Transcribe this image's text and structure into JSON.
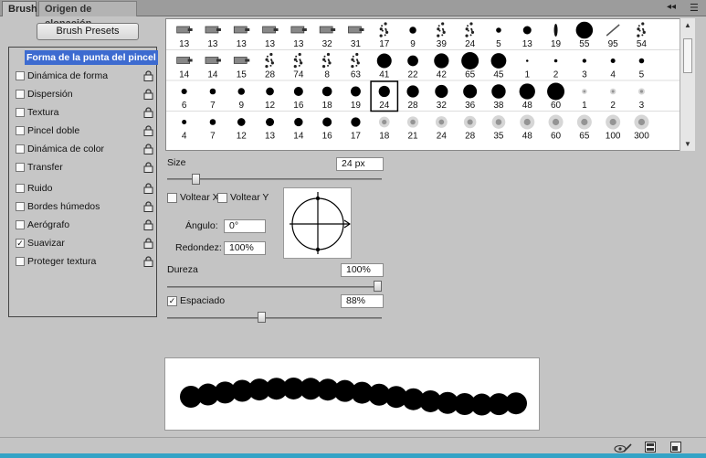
{
  "tabs": {
    "active": "Brush",
    "inactive": "Origen de clonación",
    "controls": "◂◂ ☰",
    "collapse_icon": "double-chevron-icon",
    "menu_icon": "panel-menu-icon"
  },
  "presets_button": "Brush Presets",
  "options": [
    {
      "label": "Forma de la punta del pincel",
      "checked": false,
      "selected": true,
      "lock": false,
      "nocheck": true
    },
    {
      "label": "Dinámica de forma",
      "checked": false,
      "selected": false,
      "lock": true
    },
    {
      "label": "Dispersión",
      "checked": false,
      "selected": false,
      "lock": true
    },
    {
      "label": "Textura",
      "checked": false,
      "selected": false,
      "lock": true
    },
    {
      "label": "Pincel doble",
      "checked": false,
      "selected": false,
      "lock": true
    },
    {
      "label": "Dinámica de color",
      "checked": false,
      "selected": false,
      "lock": true
    },
    {
      "label": "Transfer",
      "checked": false,
      "selected": false,
      "lock": true
    },
    {
      "label": "Ruido",
      "checked": false,
      "selected": false,
      "lock": true
    },
    {
      "label": "Bordes húmedos",
      "checked": false,
      "selected": false,
      "lock": true
    },
    {
      "label": "Aerógrafo",
      "checked": false,
      "selected": false,
      "lock": true
    },
    {
      "label": "Suavizar",
      "checked": true,
      "selected": false,
      "lock": true
    },
    {
      "label": "Proteger textura",
      "checked": false,
      "selected": false,
      "lock": true
    }
  ],
  "brush_rows": [
    [
      "13",
      "13",
      "13",
      "13",
      "13",
      "32",
      "31",
      "17",
      "9",
      "39",
      "24",
      "5",
      "13",
      "19",
      "55",
      "95",
      "54"
    ],
    [
      "14",
      "14",
      "15",
      "28",
      "74",
      "8",
      "63",
      "41",
      "22",
      "42",
      "65",
      "45",
      "1",
      "2",
      "3",
      "4",
      "5"
    ],
    [
      "6",
      "7",
      "9",
      "12",
      "16",
      "18",
      "19",
      "24",
      "28",
      "32",
      "36",
      "38",
      "48",
      "60",
      "1",
      "2",
      "3"
    ],
    [
      "4",
      "7",
      "12",
      "13",
      "14",
      "16",
      "17",
      "18",
      "21",
      "24",
      "28",
      "35",
      "48",
      "60",
      "65",
      "100",
      "300"
    ]
  ],
  "selected_brush": "24",
  "size": {
    "label": "Size",
    "value": "24 px",
    "slider": 0.12
  },
  "flip": {
    "x_label": "Voltear X",
    "y_label": "Voltear Y",
    "x_checked": false,
    "y_checked": false
  },
  "angle": {
    "label": "Ángulo:",
    "value": "0°"
  },
  "roundness": {
    "label": "Redondez:",
    "value": "100%"
  },
  "hardness": {
    "label": "Dureza",
    "value": "100%",
    "slider": 1.0
  },
  "spacing": {
    "label": "Espaciado",
    "value": "88%",
    "checked": true,
    "slider": 0.44
  },
  "bottom_icons": [
    "eye-brush-icon",
    "grid-icon",
    "new-preset-icon"
  ]
}
